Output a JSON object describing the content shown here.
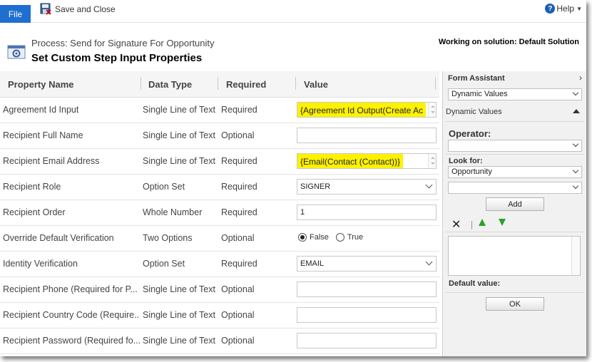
{
  "ribbon": {
    "file_label": "File",
    "save_close_label": "Save and Close",
    "help_label": "Help"
  },
  "header": {
    "process_subtitle": "Process: Send for Signature For Opportunity",
    "title": "Set Custom Step Input Properties",
    "solution_text": "Working on solution: Default Solution"
  },
  "grid": {
    "columns": [
      "Property Name",
      "Data Type",
      "Required",
      "Value"
    ],
    "rows": [
      {
        "name": "Agreement Id Input",
        "type": "Single Line of Text",
        "required": "Required",
        "value": "{Agreement Id Output(Create Ac"
      },
      {
        "name": "Recipient Full Name",
        "type": "Single Line of Text",
        "required": "Optional",
        "value": ""
      },
      {
        "name": "Recipient Email Address",
        "type": "Single Line of Text",
        "required": "Required",
        "value": "{Email(Contact (Contact))}"
      },
      {
        "name": "Recipient Role",
        "type": "Option Set",
        "required": "Required",
        "value": "SIGNER"
      },
      {
        "name": "Recipient Order",
        "type": "Whole Number",
        "required": "Required",
        "value": "1"
      },
      {
        "name": "Override Default Verification",
        "type": "Two Options",
        "required": "Optional",
        "value": "False"
      },
      {
        "name": "Identity Verification",
        "type": "Option Set",
        "required": "Required",
        "value": "EMAIL"
      },
      {
        "name": "Recipient Phone (Required for P...",
        "type": "Single Line of Text",
        "required": "Optional",
        "value": ""
      },
      {
        "name": "Recipient Country Code (Require...",
        "type": "Single Line of Text",
        "required": "Optional",
        "value": ""
      },
      {
        "name": "Recipient Password (Required fo...",
        "type": "Single Line of Text",
        "required": "Optional",
        "value": ""
      }
    ],
    "radio_options": {
      "false_label": "False",
      "true_label": "True",
      "selected": "False"
    }
  },
  "form_assistant": {
    "title": "Form Assistant",
    "source_select": "Dynamic Values",
    "section_label": "Dynamic Values",
    "operator_label": "Operator:",
    "operator_value": "",
    "look_for_label": "Look for:",
    "look_for_value": "Opportunity",
    "field_value": "",
    "add_label": "Add",
    "default_value_label": "Default value:",
    "ok_label": "OK"
  },
  "colors": {
    "file_tab": "#1e6fcf",
    "highlight": "#fff200",
    "move_arrows": "#2aa12a"
  }
}
